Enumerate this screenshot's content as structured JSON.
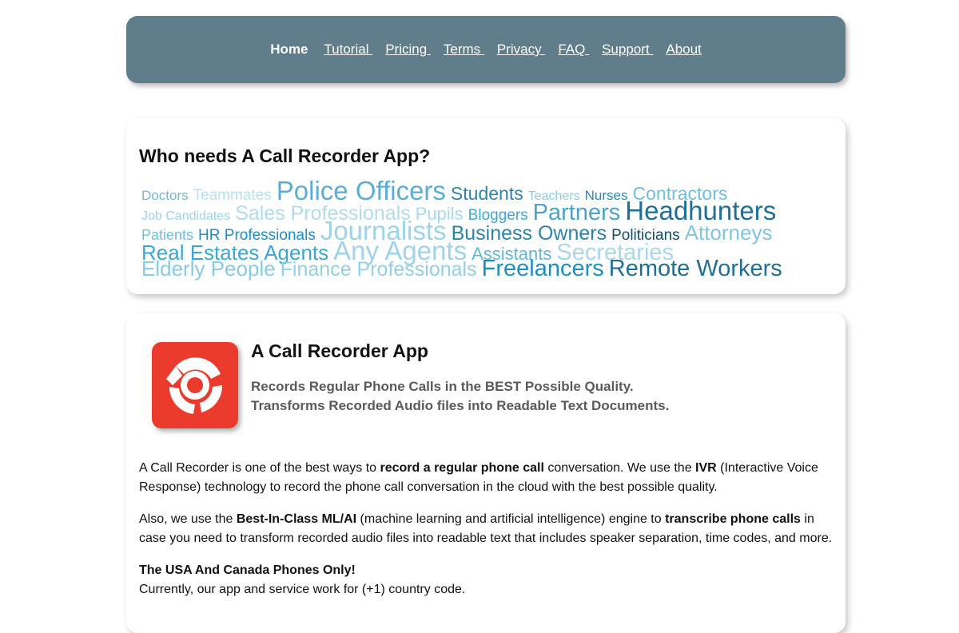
{
  "nav": {
    "items": [
      {
        "label": "Home",
        "active": true
      },
      {
        "label": "Tutorial ",
        "active": false
      },
      {
        "label": "Pricing ",
        "active": false
      },
      {
        "label": "Terms ",
        "active": false
      },
      {
        "label": "Privacy ",
        "active": false
      },
      {
        "label": "FAQ ",
        "active": false
      },
      {
        "label": "Support ",
        "active": false
      },
      {
        "label": "About",
        "active": false
      }
    ]
  },
  "who": {
    "title": "Who needs A Call Recorder App?",
    "cloud": [
      [
        {
          "text": "Doctors",
          "size": 17,
          "color": "#6fbad9"
        },
        {
          "text": "Teammates",
          "size": 19,
          "color": "#b7e0f0"
        },
        {
          "text": "Police Officers",
          "size": 33,
          "color": "#5aaed6"
        },
        {
          "text": "Students",
          "size": 23,
          "color": "#2f84ad"
        },
        {
          "text": "Teachers",
          "size": 16,
          "color": "#88cbe6"
        },
        {
          "text": "Nurses",
          "size": 17,
          "color": "#1e8dc6"
        },
        {
          "text": "Contractors",
          "size": 23,
          "color": "#6fbfe0"
        }
      ],
      [
        {
          "text": "Job Candidates",
          "size": 16,
          "color": "#9fd3e9"
        },
        {
          "text": "Sales Professionals",
          "size": 25,
          "color": "#b0dcee"
        },
        {
          "text": "Pupils",
          "size": 22,
          "color": "#a9d9ee"
        },
        {
          "text": "Bloggers",
          "size": 19,
          "color": "#3ea8d8"
        },
        {
          "text": "Partners",
          "size": 29,
          "color": "#4ba3cc"
        },
        {
          "text": "Headhunters",
          "size": 33,
          "color": "#1f6f99"
        }
      ],
      [
        {
          "text": "Patients",
          "size": 18,
          "color": "#6fc0e2"
        },
        {
          "text": "HR Professionals",
          "size": 19,
          "color": "#1a8fc8"
        },
        {
          "text": "Journalists",
          "size": 33,
          "color": "#9dd3eb"
        },
        {
          "text": "Business Owners",
          "size": 25,
          "color": "#2b84ad"
        },
        {
          "text": "Politicians",
          "size": 19,
          "color": "#124d6b"
        },
        {
          "text": "Attorneys",
          "size": 26,
          "color": "#7ec6e4"
        }
      ],
      [
        {
          "text": "Real Estates Agents",
          "size": 26,
          "color": "#3aa7d8"
        },
        {
          "text": "Any Agents",
          "size": 33,
          "color": "#9fd3eb"
        },
        {
          "text": "Assistants",
          "size": 22,
          "color": "#5fb6dc"
        },
        {
          "text": "Secretaries",
          "size": 29,
          "color": "#a9d8ec"
        }
      ],
      [
        {
          "text": "Elderly People",
          "size": 26,
          "color": "#87cbe7"
        },
        {
          "text": "Finance Professionals",
          "size": 25,
          "color": "#93cfe9"
        },
        {
          "text": "Freelancers",
          "size": 29,
          "color": "#1d8fc7"
        },
        {
          "text": "Remote Workers",
          "size": 29,
          "color": "#1f6e98"
        }
      ]
    ]
  },
  "app": {
    "icon": "phone-recorder-icon",
    "icon_color": "#ea3b2c",
    "title": "A Call Recorder App",
    "subtitle_1": "Records Regular Phone Calls in the BEST Possible Quality.",
    "subtitle_2": "Transforms Recorded Audio files into Readable Text Documents.",
    "p1": {
      "a": "A Call Recorder is one of the best ways to ",
      "b": "record a regular phone call",
      "c": " conversation. We use the ",
      "d": "IVR",
      "e": " (Interactive Voice Response) technology to record the phone call conversation in the cloud with the best possible quality."
    },
    "p2": {
      "a": "Also, we use the ",
      "b": "Best-In-Class ML/AI",
      "c": " (machine learning and artificial intelligence) engine to ",
      "d": "transcribe phone calls",
      "e": " in case you need to transform recorded audio files into readable text that includes speaker separation, time codes, and more."
    },
    "p3": {
      "heading": "The USA And Canada Phones Only!",
      "text": "Currently, our app and service work for (+1) country code."
    }
  },
  "colors": {
    "nav_bg": "#607d8b",
    "subtitle": "#5a5a5a"
  }
}
